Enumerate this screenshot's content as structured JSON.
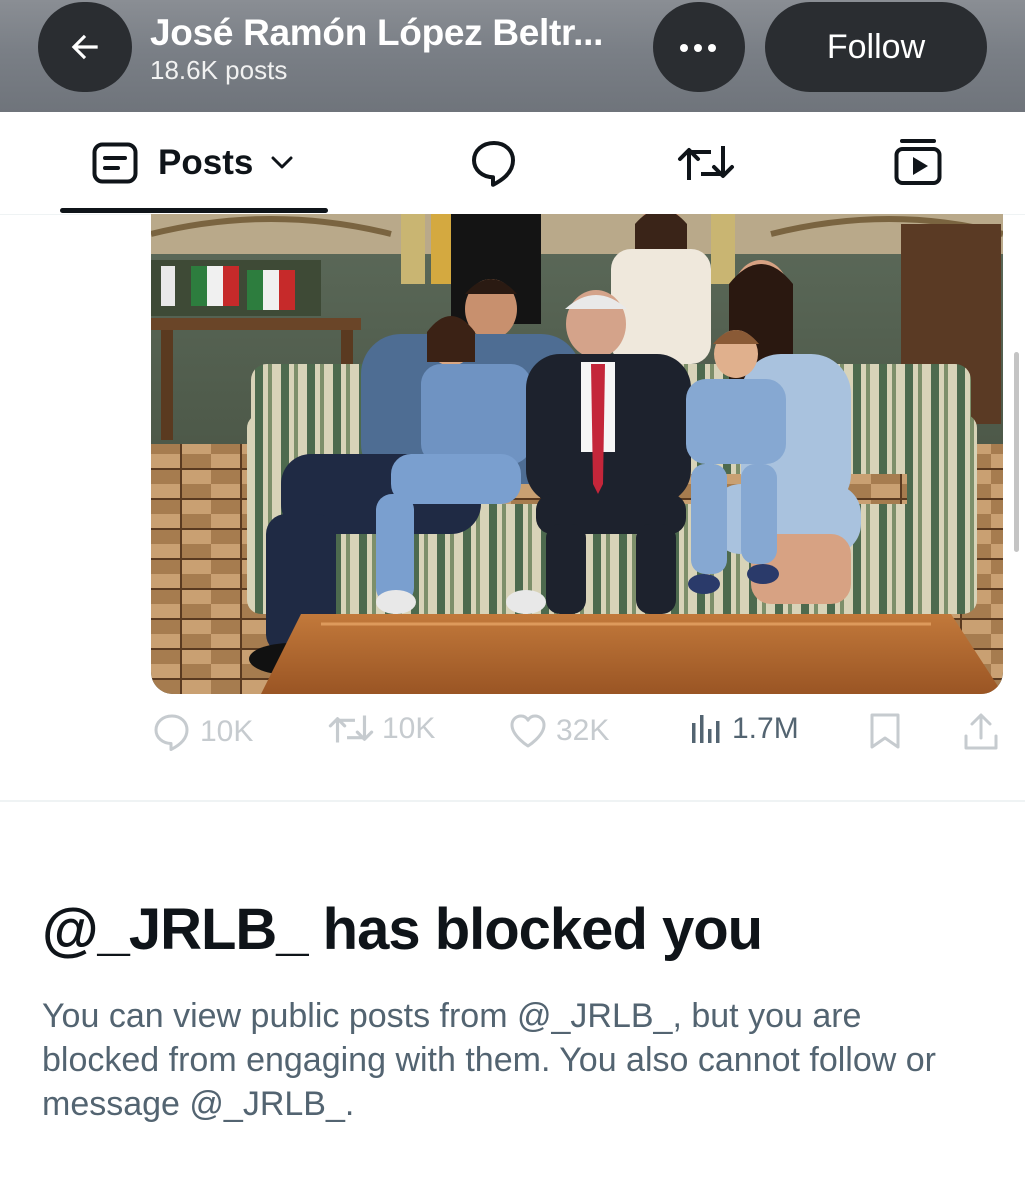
{
  "header": {
    "profile_name": "José Ramón López Beltr...",
    "posts_count": "18.6K posts",
    "follow_label": "Follow",
    "back_icon": "arrow-left-icon",
    "more_icon": "more-dots-icon"
  },
  "tabs": {
    "active_label": "Posts",
    "items": [
      {
        "icon": "posts-list-icon",
        "label": "Posts"
      },
      {
        "icon": "reply-bubble-icon"
      },
      {
        "icon": "repost-icon"
      },
      {
        "icon": "media-icon"
      }
    ]
  },
  "post": {
    "image_alt": "Family photo on a striped sofa in a palace room",
    "stats": {
      "replies": "10K",
      "reposts": "10K",
      "likes": "32K",
      "views": "1.7M"
    }
  },
  "blocked": {
    "title": "@_JRLB_ has blocked you",
    "body": "You can view public posts from @_JRLB_, but you are blocked from engaging with them. You also cannot follow or message @_JRLB_."
  },
  "colors": {
    "text_primary": "#0f1419",
    "text_secondary": "#536471",
    "faded": "#c6cbcf",
    "pill": "#2a2d31"
  }
}
